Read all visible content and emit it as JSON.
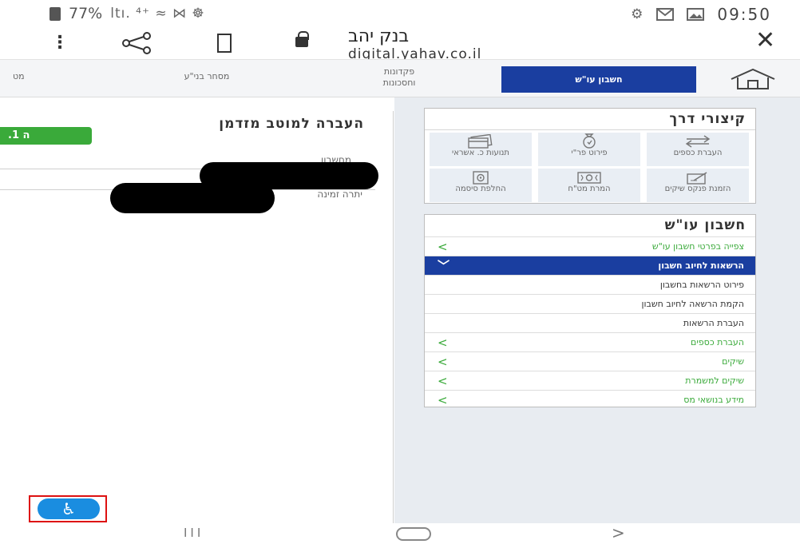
{
  "status_bar": {
    "battery": "77%",
    "signal_text": "ltı. ⁴⁺ ≈ ⋈ ☸",
    "settings_glyph": "⚙",
    "time": "09:50"
  },
  "browser": {
    "title": "בנק יהב",
    "url": "digital.yahav.co.il"
  },
  "nav": {
    "active": "חשבון עו\"ש",
    "item1_line1": "פקדונות",
    "item1_line2": "וחסכונות",
    "item2": "מסחר בני\"ע",
    "item3": "מט"
  },
  "left_panel": {
    "title": "העברה למוטב מזדמן",
    "step": ".1 ה",
    "account_label": "מחשבון",
    "available_label": "יתרה זמינה"
  },
  "shortcuts": {
    "title": "קיצורי דרך",
    "tiles": [
      {
        "label": "העברת כספים",
        "icon": "transfer-icon"
      },
      {
        "label": "פירוט פר\"י",
        "icon": "bag-icon"
      },
      {
        "label": "תנועות כ. אשראי",
        "icon": "credit-card-icon"
      },
      {
        "label": "הזמנת פנקס שיקים",
        "icon": "checkbook-icon"
      },
      {
        "label": "המרת מט\"ח",
        "icon": "currency-exchange-icon"
      },
      {
        "label": "החלפת סיסמה",
        "icon": "password-icon"
      }
    ]
  },
  "account_menu": {
    "title": "חשבון עו\"ש",
    "rows": [
      {
        "label": "צפייה בפרטי חשבון עו\"ש",
        "kind": "green",
        "chevron": "<"
      },
      {
        "label": "הרשאות לחיוב חשבון",
        "kind": "active",
        "chevron": "﹀"
      },
      {
        "label": "פירוט הרשאות בחשבון",
        "kind": "sub",
        "chevron": ""
      },
      {
        "label": "הקמת הרשאה לחיוב חשבון",
        "kind": "sub",
        "chevron": ""
      },
      {
        "label": "העברת הרשאות",
        "kind": "sub",
        "chevron": ""
      },
      {
        "label": "העברת כספים",
        "kind": "green",
        "chevron": "<"
      },
      {
        "label": "שיקים",
        "kind": "green",
        "chevron": "<"
      },
      {
        "label": "שיקים למשמרת",
        "kind": "green",
        "chevron": "<"
      },
      {
        "label": "מידע בנושאי מס",
        "kind": "green",
        "chevron": "<"
      }
    ]
  },
  "accessibility": {
    "glyph": "♿"
  },
  "bottom_nav": {
    "recent": "III",
    "back": ">"
  }
}
